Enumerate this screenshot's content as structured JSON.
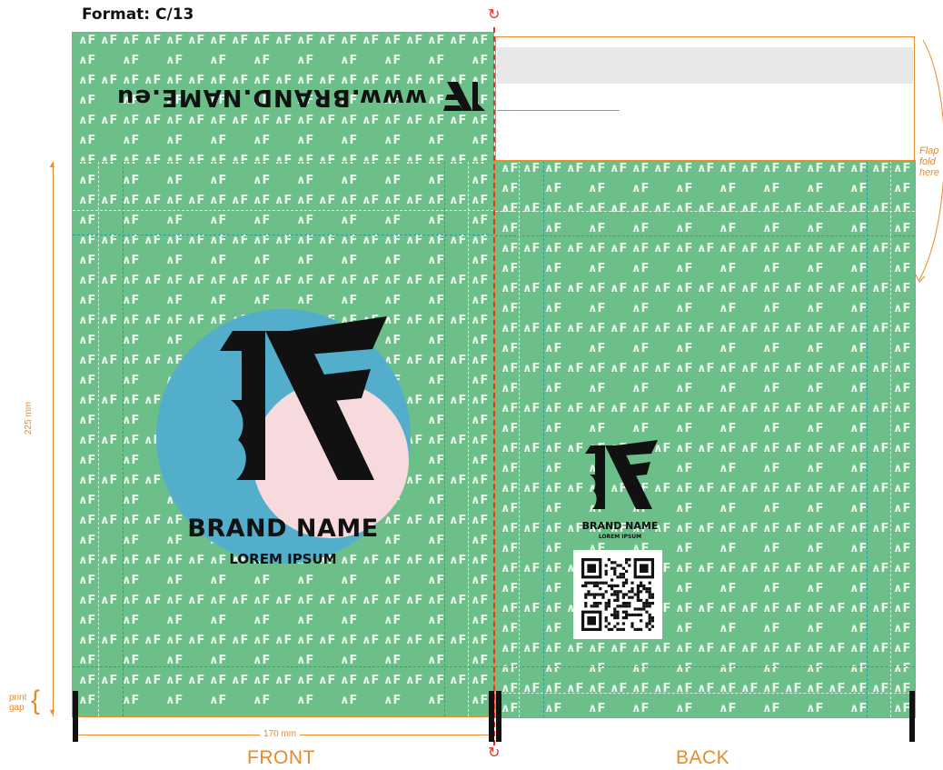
{
  "page_title": "Format: C/13",
  "front": {
    "label": "FRONT",
    "flap_url_text": "www.BRAND.NAME.eu",
    "brand_name": "BRAND NAME",
    "tagline": "LOREM IPSUM"
  },
  "back": {
    "label": "BACK",
    "brand_name": "BRAND NAME",
    "tagline": "LOREM IPSUM"
  },
  "dimensions": {
    "height_label": "225 mm",
    "width_label": "170 mm",
    "print_gap_label_1": "print",
    "print_gap_label_2": "gap"
  },
  "flap_note": {
    "line1": "Flap",
    "line2": "fold",
    "line3": "here"
  },
  "colors": {
    "background_green": "#6dbf8a",
    "guide_orange": "#e88a2e",
    "circle_blue": "#52aecb",
    "circle_pink": "#f6dade",
    "logo_black": "#111111"
  },
  "pattern_glyph": "∧F"
}
